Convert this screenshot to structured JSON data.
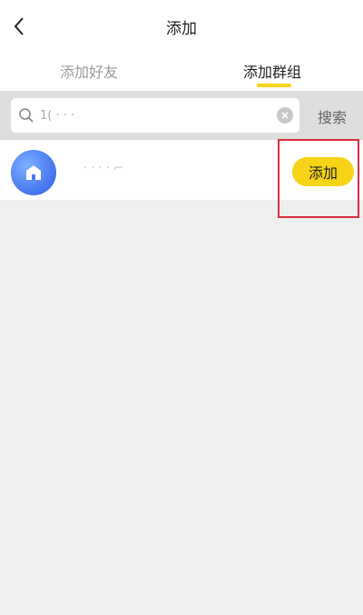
{
  "header": {
    "title": "添加"
  },
  "tabs": [
    {
      "label": "添加好友",
      "active": false
    },
    {
      "label": "添加群组",
      "active": true
    }
  ],
  "search": {
    "value": "1( · · ·",
    "button_label": "搜索"
  },
  "results": [
    {
      "name": "· · ·   ·  ⌐",
      "action_label": "添加"
    }
  ],
  "colors": {
    "accent": "#f7d417",
    "highlight": "#d6303b",
    "avatar": "#4a7cf0"
  }
}
